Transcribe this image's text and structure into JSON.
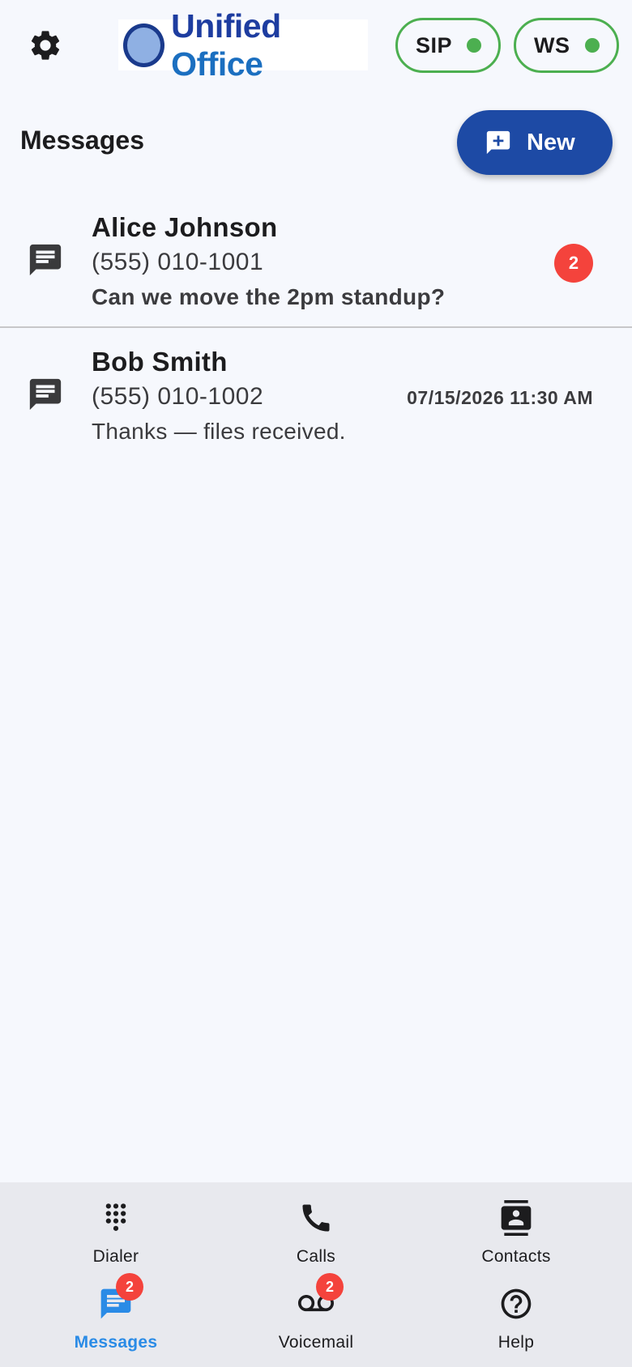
{
  "header": {
    "logo_text_1": "Unified",
    "logo_text_2": "Office",
    "status": [
      {
        "label": "SIP",
        "state": "connected",
        "color": "#4caf50"
      },
      {
        "label": "WS",
        "state": "connected",
        "color": "#4caf50"
      }
    ]
  },
  "page": {
    "title": "Messages",
    "new_button_label": "New"
  },
  "conversations": [
    {
      "name": "Alice Johnson",
      "number": "(555) 010-1001",
      "preview": "Can we move the 2pm standup?",
      "unread": "2",
      "timestamp": ""
    },
    {
      "name": "Bob Smith",
      "number": "(555) 010-1002",
      "preview": "Thanks — files received.",
      "unread": "",
      "timestamp": "07/15/2026 11:30 AM"
    }
  ],
  "nav": {
    "items": [
      {
        "label": "Dialer",
        "icon": "dialpad-icon"
      },
      {
        "label": "Calls",
        "icon": "phone-icon"
      },
      {
        "label": "Contacts",
        "icon": "contacts-icon"
      },
      {
        "label": "Messages",
        "icon": "message-icon",
        "badge": "2",
        "active": true
      },
      {
        "label": "Voicemail",
        "icon": "voicemail-icon",
        "badge": "2"
      },
      {
        "label": "Help",
        "icon": "help-icon"
      }
    ]
  },
  "colors": {
    "accent": "#1d4aa5",
    "active_nav": "#2a8be6",
    "badge": "#f4433c",
    "status_ok": "#4caf50"
  }
}
